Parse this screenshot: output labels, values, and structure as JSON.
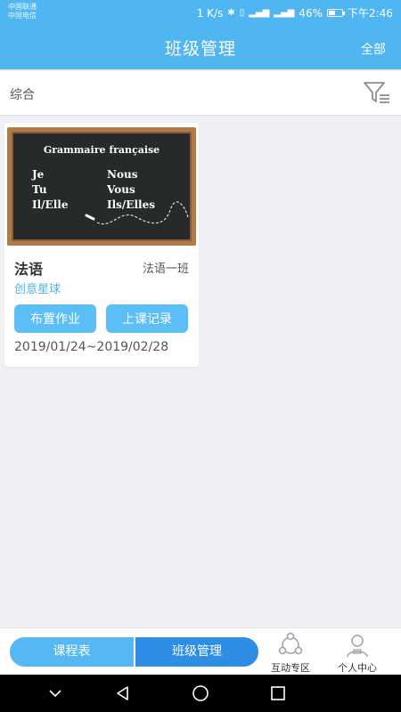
{
  "status_bar": {
    "carrier1": "中国联通",
    "carrier2": "中国电信",
    "net_speed": "1 K/s",
    "battery": "46%",
    "time": "下午2:46"
  },
  "header": {
    "title": "班级管理",
    "right_action": "全部",
    "bg_color": "#4fb6f1"
  },
  "filter": {
    "label": "综合",
    "icon": "filter-icon"
  },
  "class_card": {
    "image": {
      "title": "Grammaire française",
      "left_col": [
        "Je",
        "Tu",
        "Il/Elle"
      ],
      "right_col": [
        "Nous",
        "Vous",
        "Ils/Elles"
      ]
    },
    "course_name": "法语",
    "class_name": "法语一班",
    "subtitle": "创意星球",
    "assign_button": "布置作业",
    "record_button": "上课记录",
    "date_range": "2019/01/24~2019/02/28"
  },
  "bottom_nav": {
    "schedule_tab": "课程表",
    "class_tab": "班级管理",
    "interact_label": "互动专区",
    "profile_label": "个人中心"
  }
}
